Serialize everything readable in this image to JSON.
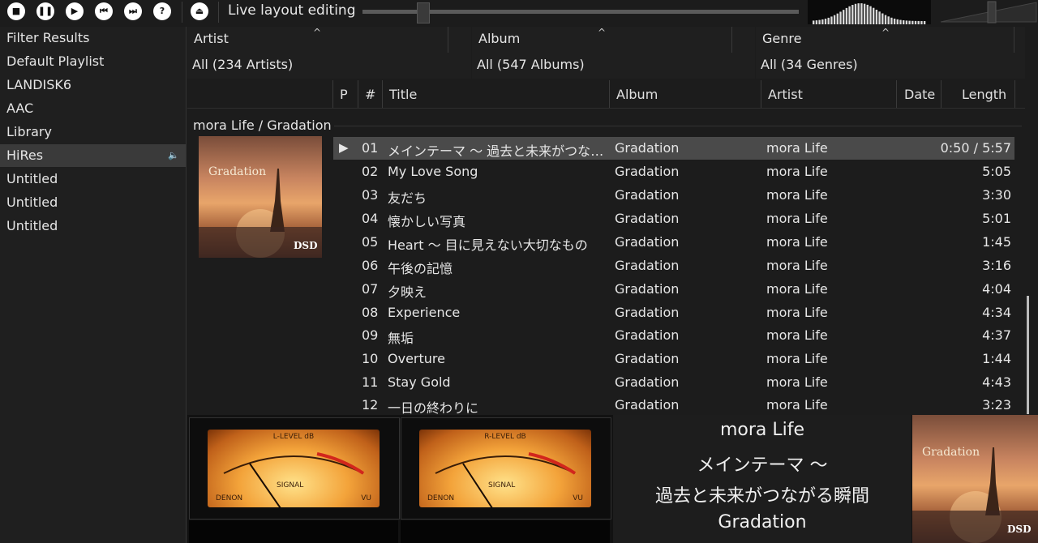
{
  "toolbar": {
    "buttons": [
      {
        "name": "stop-icon",
        "glyph": "■"
      },
      {
        "name": "pause-icon",
        "glyph": "❚❚"
      },
      {
        "name": "play-icon",
        "glyph": "▶"
      },
      {
        "name": "previous-icon",
        "glyph": "⏮"
      },
      {
        "name": "next-icon",
        "glyph": "⏭"
      },
      {
        "name": "random-icon",
        "glyph": "?"
      },
      {
        "name": "eject-icon",
        "glyph": "⏏"
      }
    ],
    "live_layout_label": "Live layout editing"
  },
  "sidebar": {
    "items": [
      {
        "label": "Filter Results"
      },
      {
        "label": "Default Playlist"
      },
      {
        "label": "LANDISK6"
      },
      {
        "label": "AAC"
      },
      {
        "label": "Library"
      },
      {
        "label": "HiRes",
        "selected": true,
        "playing_icon": "speaker-icon"
      },
      {
        "label": "Untitled"
      },
      {
        "label": "Untitled"
      },
      {
        "label": "Untitled"
      }
    ]
  },
  "filters": [
    {
      "header": "Artist",
      "value": "All (234 Artists)"
    },
    {
      "header": "Album",
      "value": "All (547 Albums)"
    },
    {
      "header": "Genre",
      "value": "All (34 Genres)"
    }
  ],
  "playlist": {
    "columns": {
      "p": "P",
      "num": "#",
      "title": "Title",
      "album": "Album",
      "artist": "Artist",
      "date": "Date",
      "length": "Length"
    },
    "group": "mora Life / Gradation",
    "rows": [
      {
        "play": "▶",
        "num": "01",
        "title": "メインテーマ 〜 過去と未来がつなが...",
        "album": "Gradation",
        "artist": "mora Life",
        "length": "0:50 / 5:57"
      },
      {
        "play": "",
        "num": "02",
        "title": "My Love Song",
        "album": "Gradation",
        "artist": "mora Life",
        "length": "5:05"
      },
      {
        "play": "",
        "num": "03",
        "title": "友だち",
        "album": "Gradation",
        "artist": "mora Life",
        "length": "3:30"
      },
      {
        "play": "",
        "num": "04",
        "title": "懐かしい写真",
        "album": "Gradation",
        "artist": "mora Life",
        "length": "5:01"
      },
      {
        "play": "",
        "num": "05",
        "title": "Heart 〜 目に見えない大切なもの",
        "album": "Gradation",
        "artist": "mora Life",
        "length": "1:45"
      },
      {
        "play": "",
        "num": "06",
        "title": "午後の記憶",
        "album": "Gradation",
        "artist": "mora Life",
        "length": "3:16"
      },
      {
        "play": "",
        "num": "07",
        "title": "夕映え",
        "album": "Gradation",
        "artist": "mora Life",
        "length": "4:04"
      },
      {
        "play": "",
        "num": "08",
        "title": "Experience",
        "album": "Gradation",
        "artist": "mora Life",
        "length": "4:34"
      },
      {
        "play": "",
        "num": "09",
        "title": "無垢",
        "album": "Gradation",
        "artist": "mora Life",
        "length": "4:37"
      },
      {
        "play": "",
        "num": "10",
        "title": "Overture",
        "album": "Gradation",
        "artist": "mora Life",
        "length": "1:44"
      },
      {
        "play": "",
        "num": "11",
        "title": "Stay Gold",
        "album": "Gradation",
        "artist": "mora Life",
        "length": "4:43"
      },
      {
        "play": "",
        "num": "12",
        "title": "一日の終わりに",
        "album": "Gradation",
        "artist": "mora Life",
        "length": "3:23"
      }
    ]
  },
  "album_art": {
    "title": "Gradation",
    "badge": "DSD"
  },
  "vu_meters": [
    {
      "label": "L-LEVEL dB",
      "brand": "DENON",
      "signal": "SIGNAL",
      "unit": "VU"
    },
    {
      "label": "R-LEVEL dB",
      "brand": "DENON",
      "signal": "SIGNAL",
      "unit": "VU"
    }
  ],
  "now_playing": {
    "artist": "mora Life",
    "title_line1": "メインテーマ 〜",
    "title_line2": "過去と未来がつながる瞬間",
    "album": "Gradation"
  },
  "colors": {
    "accent_red": "#d2261c",
    "vu_amber": "#f3a33a"
  }
}
